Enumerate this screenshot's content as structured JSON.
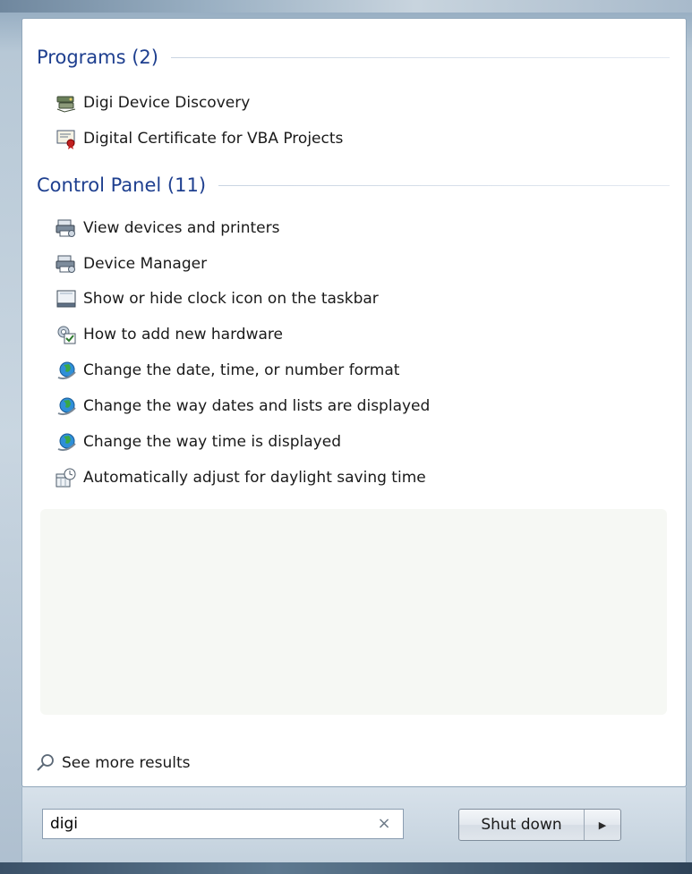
{
  "programs": {
    "header": "Programs (2)",
    "items": [
      {
        "label": "Digi Device Discovery",
        "icon": "digi-device-icon"
      },
      {
        "label": "Digital Certificate for VBA Projects",
        "icon": "certificate-icon"
      }
    ]
  },
  "control_panel": {
    "header": "Control Panel (11)",
    "items": [
      {
        "label": "View devices and printers",
        "icon": "devices-printers-icon"
      },
      {
        "label": "Device Manager",
        "icon": "device-manager-icon"
      },
      {
        "label": "Show or hide clock icon on the taskbar",
        "icon": "taskbar-icon"
      },
      {
        "label": "How to add new hardware",
        "icon": "hardware-icon"
      },
      {
        "label": "Change the date, time, or number format",
        "icon": "globe-icon"
      },
      {
        "label": "Change the way dates and lists are displayed",
        "icon": "globe-icon"
      },
      {
        "label": "Change the way time is displayed",
        "icon": "globe-icon"
      },
      {
        "label": "Automatically adjust for daylight saving time",
        "icon": "calendar-clock-icon"
      }
    ]
  },
  "see_more": {
    "label": "See more results",
    "icon": "search-icon"
  },
  "search": {
    "value": "digi",
    "clear_icon": "close-icon"
  },
  "shutdown": {
    "label": "Shut down",
    "arrow_icon": "chevron-right-icon"
  },
  "colors": {
    "header": "#1e3f8f",
    "panel": "#ffffff",
    "band": "#c3d1dd"
  }
}
